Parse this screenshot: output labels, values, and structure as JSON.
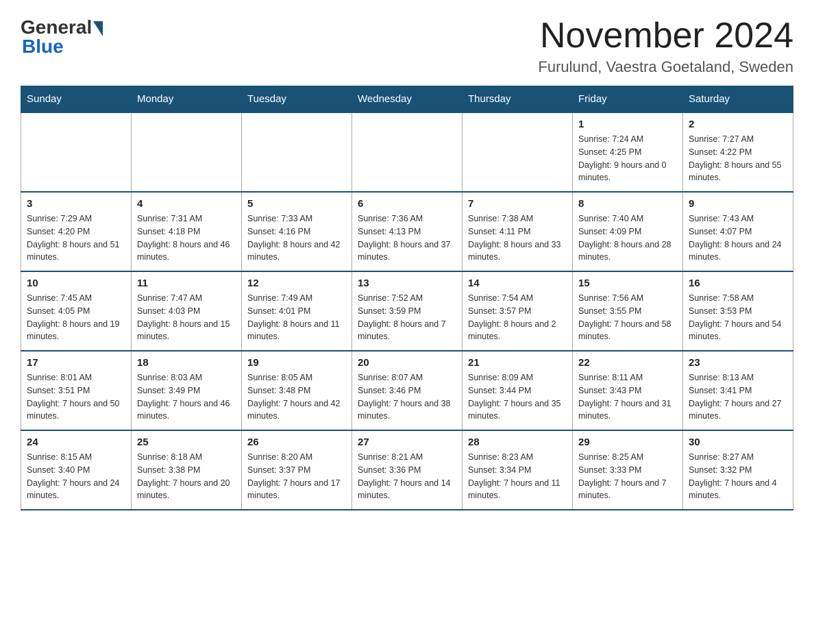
{
  "header": {
    "logo_general": "General",
    "logo_blue": "Blue",
    "month_title": "November 2024",
    "location": "Furulund, Vaestra Goetaland, Sweden"
  },
  "weekdays": [
    "Sunday",
    "Monday",
    "Tuesday",
    "Wednesday",
    "Thursday",
    "Friday",
    "Saturday"
  ],
  "weeks": [
    [
      {
        "day": "",
        "info": ""
      },
      {
        "day": "",
        "info": ""
      },
      {
        "day": "",
        "info": ""
      },
      {
        "day": "",
        "info": ""
      },
      {
        "day": "",
        "info": ""
      },
      {
        "day": "1",
        "info": "Sunrise: 7:24 AM\nSunset: 4:25 PM\nDaylight: 9 hours and 0 minutes."
      },
      {
        "day": "2",
        "info": "Sunrise: 7:27 AM\nSunset: 4:22 PM\nDaylight: 8 hours and 55 minutes."
      }
    ],
    [
      {
        "day": "3",
        "info": "Sunrise: 7:29 AM\nSunset: 4:20 PM\nDaylight: 8 hours and 51 minutes."
      },
      {
        "day": "4",
        "info": "Sunrise: 7:31 AM\nSunset: 4:18 PM\nDaylight: 8 hours and 46 minutes."
      },
      {
        "day": "5",
        "info": "Sunrise: 7:33 AM\nSunset: 4:16 PM\nDaylight: 8 hours and 42 minutes."
      },
      {
        "day": "6",
        "info": "Sunrise: 7:36 AM\nSunset: 4:13 PM\nDaylight: 8 hours and 37 minutes."
      },
      {
        "day": "7",
        "info": "Sunrise: 7:38 AM\nSunset: 4:11 PM\nDaylight: 8 hours and 33 minutes."
      },
      {
        "day": "8",
        "info": "Sunrise: 7:40 AM\nSunset: 4:09 PM\nDaylight: 8 hours and 28 minutes."
      },
      {
        "day": "9",
        "info": "Sunrise: 7:43 AM\nSunset: 4:07 PM\nDaylight: 8 hours and 24 minutes."
      }
    ],
    [
      {
        "day": "10",
        "info": "Sunrise: 7:45 AM\nSunset: 4:05 PM\nDaylight: 8 hours and 19 minutes."
      },
      {
        "day": "11",
        "info": "Sunrise: 7:47 AM\nSunset: 4:03 PM\nDaylight: 8 hours and 15 minutes."
      },
      {
        "day": "12",
        "info": "Sunrise: 7:49 AM\nSunset: 4:01 PM\nDaylight: 8 hours and 11 minutes."
      },
      {
        "day": "13",
        "info": "Sunrise: 7:52 AM\nSunset: 3:59 PM\nDaylight: 8 hours and 7 minutes."
      },
      {
        "day": "14",
        "info": "Sunrise: 7:54 AM\nSunset: 3:57 PM\nDaylight: 8 hours and 2 minutes."
      },
      {
        "day": "15",
        "info": "Sunrise: 7:56 AM\nSunset: 3:55 PM\nDaylight: 7 hours and 58 minutes."
      },
      {
        "day": "16",
        "info": "Sunrise: 7:58 AM\nSunset: 3:53 PM\nDaylight: 7 hours and 54 minutes."
      }
    ],
    [
      {
        "day": "17",
        "info": "Sunrise: 8:01 AM\nSunset: 3:51 PM\nDaylight: 7 hours and 50 minutes."
      },
      {
        "day": "18",
        "info": "Sunrise: 8:03 AM\nSunset: 3:49 PM\nDaylight: 7 hours and 46 minutes."
      },
      {
        "day": "19",
        "info": "Sunrise: 8:05 AM\nSunset: 3:48 PM\nDaylight: 7 hours and 42 minutes."
      },
      {
        "day": "20",
        "info": "Sunrise: 8:07 AM\nSunset: 3:46 PM\nDaylight: 7 hours and 38 minutes."
      },
      {
        "day": "21",
        "info": "Sunrise: 8:09 AM\nSunset: 3:44 PM\nDaylight: 7 hours and 35 minutes."
      },
      {
        "day": "22",
        "info": "Sunrise: 8:11 AM\nSunset: 3:43 PM\nDaylight: 7 hours and 31 minutes."
      },
      {
        "day": "23",
        "info": "Sunrise: 8:13 AM\nSunset: 3:41 PM\nDaylight: 7 hours and 27 minutes."
      }
    ],
    [
      {
        "day": "24",
        "info": "Sunrise: 8:15 AM\nSunset: 3:40 PM\nDaylight: 7 hours and 24 minutes."
      },
      {
        "day": "25",
        "info": "Sunrise: 8:18 AM\nSunset: 3:38 PM\nDaylight: 7 hours and 20 minutes."
      },
      {
        "day": "26",
        "info": "Sunrise: 8:20 AM\nSunset: 3:37 PM\nDaylight: 7 hours and 17 minutes."
      },
      {
        "day": "27",
        "info": "Sunrise: 8:21 AM\nSunset: 3:36 PM\nDaylight: 7 hours and 14 minutes."
      },
      {
        "day": "28",
        "info": "Sunrise: 8:23 AM\nSunset: 3:34 PM\nDaylight: 7 hours and 11 minutes."
      },
      {
        "day": "29",
        "info": "Sunrise: 8:25 AM\nSunset: 3:33 PM\nDaylight: 7 hours and 7 minutes."
      },
      {
        "day": "30",
        "info": "Sunrise: 8:27 AM\nSunset: 3:32 PM\nDaylight: 7 hours and 4 minutes."
      }
    ]
  ]
}
